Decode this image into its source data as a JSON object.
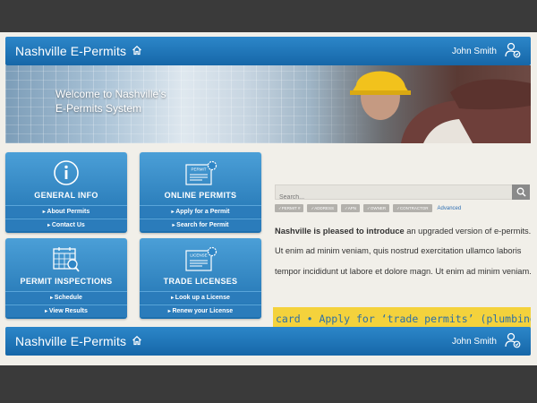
{
  "app": {
    "brand": "Nashville E-Permits",
    "user_name": "John Smith"
  },
  "hero": {
    "line1": "Welcome to Nashville’s",
    "line2": "E-Permits System"
  },
  "tiles": [
    {
      "title": "GENERAL INFO",
      "icon": "info-icon",
      "links": [
        "About Permits",
        "Contact Us"
      ]
    },
    {
      "title": "ONLINE PERMITS",
      "icon": "permit-document-icon",
      "icon_text": "PERMIT",
      "links": [
        "Apply for a Permit",
        "Search for Permit"
      ]
    },
    {
      "title": "PERMIT INSPECTIONS",
      "icon": "calendar-search-icon",
      "links": [
        "Schedule",
        "View Results"
      ]
    },
    {
      "title": "TRADE LICENSES",
      "icon": "license-document-icon",
      "icon_text": "LICENSE",
      "links": [
        "Look up a License",
        "Renew your License"
      ]
    }
  ],
  "search": {
    "placeholder": "Search...",
    "filters": [
      "PERMIT #",
      "ADDRESS",
      "APN",
      "OWNER",
      "CONTRACTOR"
    ],
    "advanced_label": "Advanced"
  },
  "intro": {
    "lead": "Nashville is pleased to introduce",
    "rest": " an upgraded version of e-permits. Ut enim ad minim veniam, quis nostrud exercitation ullamco laboris tempor incididunt ut labore et dolore magn. Ut enim ad minim veniam."
  },
  "ticker": {
    "text": "card • Apply for ‘trade permits’ (plumbing, electrica"
  },
  "colors": {
    "brand_blue": "#1667a8",
    "tile_blue": "#2b7cbb",
    "ticker_yellow": "#f4d23c",
    "page_bg": "#f1efe9"
  }
}
